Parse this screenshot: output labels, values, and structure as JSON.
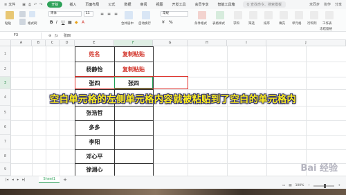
{
  "menubar": {
    "file_label": "文件",
    "tabs": [
      "开始",
      "插入",
      "页面布局",
      "公式",
      "数据",
      "审阅",
      "视图",
      "开发工具",
      "会员专享",
      "智能工具箱"
    ],
    "active_tab": "开始",
    "search_placeholder": "Q 查找命令、搜索模板",
    "right_items": [
      "未同步",
      "协作",
      "分享"
    ]
  },
  "ribbon": {
    "font_name": "宋体",
    "font_size": "11",
    "labels": [
      "粘贴",
      "格式刷",
      "合并居中",
      "自动换行",
      "常规",
      "条件格式",
      "表格样式",
      "求和",
      "筛选",
      "排序",
      "填充",
      "单元格",
      "行和列",
      "工作表",
      "冻结窗格"
    ]
  },
  "formula_bar": {
    "cell_ref": "F3",
    "content": "张四"
  },
  "grid": {
    "columns": [
      "A",
      "B",
      "C",
      "D",
      "E",
      "F",
      "G",
      "H",
      "I",
      "J"
    ],
    "selected_column": "F",
    "rows": [
      "1",
      "2",
      "3",
      "4",
      "5",
      "6",
      "7",
      "8",
      "9"
    ],
    "selected_row": "3",
    "cells": {
      "e1": "姓名",
      "f1": "复制粘贴",
      "e2": "杨静怡",
      "f2": "复制粘贴",
      "e3": "张四",
      "f3": "张四",
      "e4": "",
      "e5": "张浩哲",
      "e6": "多多",
      "e7": "李阳",
      "e8": "邓心平",
      "e9": "徐湖心"
    }
  },
  "caption": "空白单元格的左侧单元格内容就被粘贴到了空白的单元格内",
  "sheets": {
    "tabs": [
      "Sheet1"
    ],
    "add_label": "+"
  },
  "status": {
    "zoom": "100%"
  },
  "watermark": "Bai 经验",
  "colors": {
    "accent": "#2fa25a",
    "red_text": "#d2352b",
    "caption_yellow": "#ffef1e"
  }
}
